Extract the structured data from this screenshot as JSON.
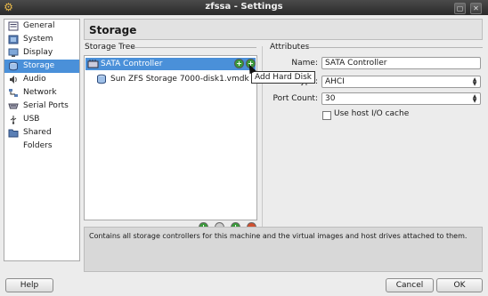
{
  "window": {
    "title": "zfssa - Settings",
    "app_icon": "gear-icon"
  },
  "sidebar": {
    "items": [
      {
        "label": "General",
        "icon": "general-icon",
        "selected": false
      },
      {
        "label": "System",
        "icon": "system-icon",
        "selected": false
      },
      {
        "label": "Display",
        "icon": "display-icon",
        "selected": false
      },
      {
        "label": "Storage",
        "icon": "storage-icon",
        "selected": true
      },
      {
        "label": "Audio",
        "icon": "audio-icon",
        "selected": false
      },
      {
        "label": "Network",
        "icon": "network-icon",
        "selected": false
      },
      {
        "label": "Serial Ports",
        "icon": "serial-ports-icon",
        "selected": false
      },
      {
        "label": "USB",
        "icon": "usb-icon",
        "selected": false
      },
      {
        "label": "Shared Folders",
        "icon": "shared-folders-icon",
        "selected": false
      }
    ]
  },
  "page": {
    "title": "Storage"
  },
  "storage_tree": {
    "label": "Storage Tree",
    "controller": {
      "label": "SATA Controller",
      "icon": "sata-controller-icon"
    },
    "disks": [
      {
        "label": "Sun ZFS Storage 7000-disk1.vmdk",
        "icon": "hard-disk-icon"
      }
    ],
    "tooltip": "Add Hard Disk"
  },
  "attributes": {
    "label": "Attributes",
    "name_label": "Name:",
    "name_value": "SATA Controller",
    "type_label": "Type:",
    "type_value": "AHCI",
    "port_count_label": "Port Count:",
    "port_count_value": "30",
    "host_io_cache_label": "Use host I/O cache",
    "host_io_cache_checked": false
  },
  "info_text": "Contains all storage controllers for this machine and the virtual images and host drives attached to them.",
  "buttons": {
    "help": "Help",
    "cancel": "Cancel",
    "ok": "OK"
  },
  "colors": {
    "selection": "#4a90d9",
    "titlebar": "#2f2f2f"
  }
}
